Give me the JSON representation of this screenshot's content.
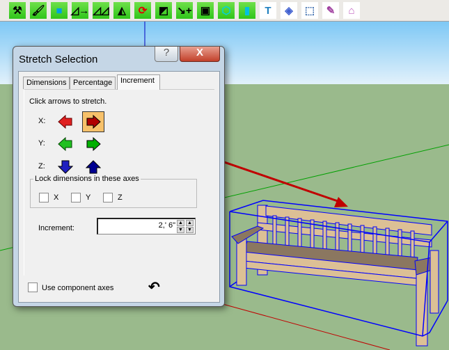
{
  "toolbar": {
    "icons": [
      "hammer-icon",
      "paintbrush-icon",
      "cube-icon",
      "stretch-x-icon",
      "stretch-xy-icon",
      "mirror-icon",
      "rotate-icon",
      "flip-face-icon",
      "measure-add-icon",
      "offset-icon",
      "box-icon",
      "bottle-icon",
      "pin-icon",
      "hatch-icon",
      "dashed-select-icon",
      "edit-form-icon",
      "house-icon"
    ]
  },
  "dialog": {
    "title": "Stretch Selection",
    "help_label": "?",
    "close_label": "X",
    "tabs": [
      {
        "label": "Dimensions",
        "active": false
      },
      {
        "label": "Percentage",
        "active": false
      },
      {
        "label": "Increment",
        "active": true
      }
    ],
    "instruction": "Click arrows to stretch.",
    "axes": [
      {
        "label": "X:",
        "color": "#c00000",
        "selected": "positive"
      },
      {
        "label": "Y:",
        "color": "#00b000"
      },
      {
        "label": "Z:",
        "color": "#000090"
      }
    ],
    "lock_group": {
      "legend": "Lock dimensions in these axes",
      "checkboxes": [
        {
          "label": "X",
          "checked": false
        },
        {
          "label": "Y",
          "checked": false
        },
        {
          "label": "Z",
          "checked": false
        }
      ]
    },
    "increment_label": "Increment:",
    "increment_value": "2,' 6\"",
    "use_component_axes": {
      "label": "Use component axes",
      "checked": false
    },
    "undo_icon": "undo-icon"
  },
  "colors": {
    "sky_top": "#7ec8f5",
    "ground": "#9aba8c",
    "selection": "#0000ff",
    "bench": "#dcc095"
  }
}
